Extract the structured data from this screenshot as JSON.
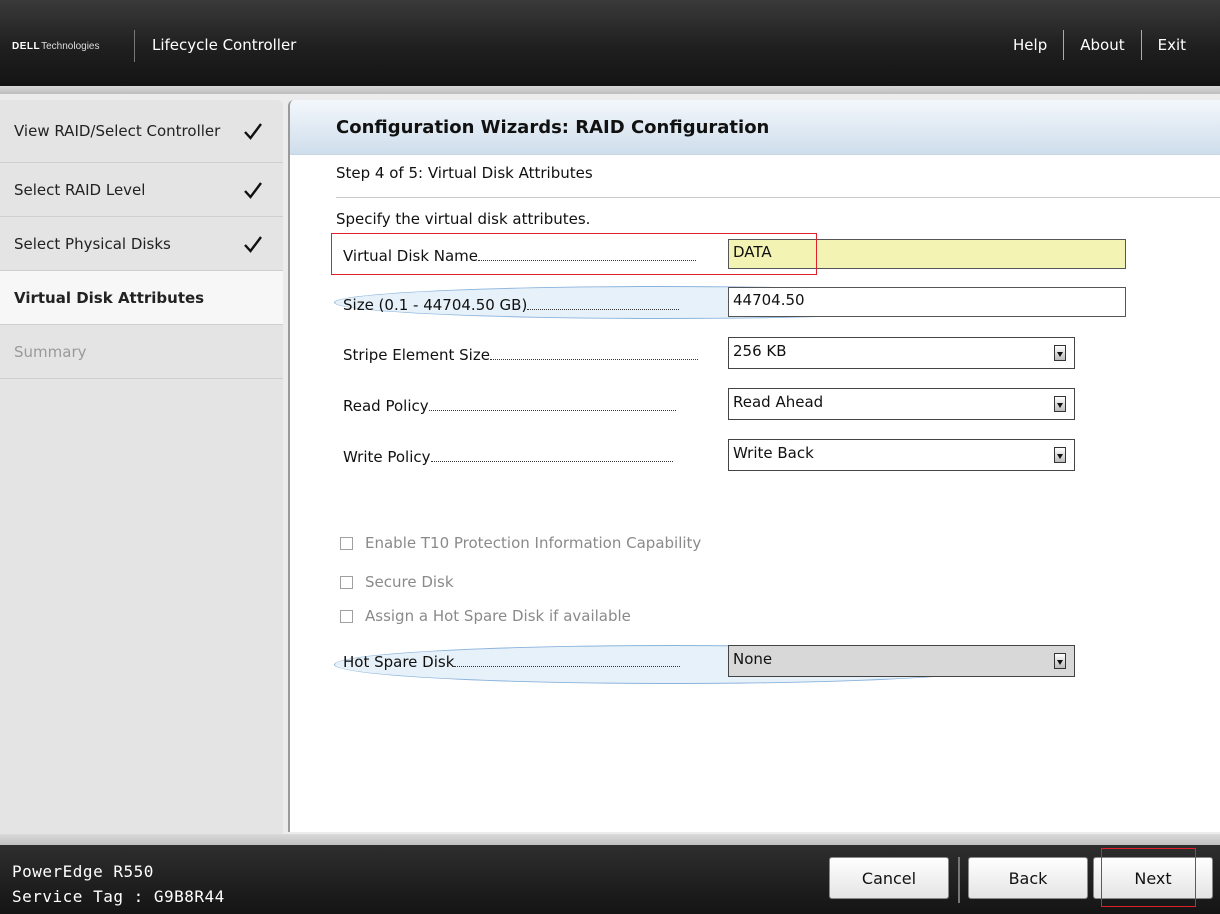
{
  "header": {
    "brand_dell": "DELL",
    "brand_tech": "Technologies",
    "app_title": "Lifecycle Controller",
    "nav": [
      "Help",
      "About",
      "Exit"
    ]
  },
  "sidebar": {
    "items": [
      {
        "label": "View RAID/Select Controller",
        "state": "done"
      },
      {
        "label": "Select RAID Level",
        "state": "done"
      },
      {
        "label": "Select Physical Disks",
        "state": "done"
      },
      {
        "label": "Virtual Disk Attributes",
        "state": "active"
      },
      {
        "label": "Summary",
        "state": "disabled"
      }
    ],
    "check_icon": "checkmark-icon"
  },
  "main": {
    "title": "Configuration Wizards: RAID Configuration",
    "step": "Step 4 of 5: Virtual Disk Attributes",
    "instructions": "Specify the virtual disk attributes.",
    "fields": {
      "vd_name": {
        "label": "Virtual Disk Name",
        "value": "DATA"
      },
      "size": {
        "label": "Size (0.1 - 44704.50 GB)",
        "value": "44704.50"
      },
      "stripe": {
        "label": "Stripe Element Size",
        "value": "256 KB"
      },
      "read_policy": {
        "label": "Read Policy",
        "value": "Read Ahead"
      },
      "write_policy": {
        "label": "Write Policy",
        "value": "Write Back"
      },
      "hot_spare": {
        "label": "Hot Spare Disk",
        "value": "None"
      }
    },
    "checkboxes": [
      {
        "label": "Enable T10 Protection Information Capability",
        "checked": false
      },
      {
        "label": "Secure Disk",
        "checked": false
      },
      {
        "label": "Assign a Hot Spare Disk if available",
        "checked": false
      }
    ]
  },
  "footer": {
    "model": "PowerEdge R550",
    "service_tag": "Service Tag : G9B8R44",
    "buttons": {
      "cancel": "Cancel",
      "back": "Back",
      "next": "Next"
    }
  },
  "colors": {
    "highlight_red": "#e0202a",
    "highlight_blue": "#8bb4dc",
    "name_field_yellow": "#f3f3b3"
  }
}
